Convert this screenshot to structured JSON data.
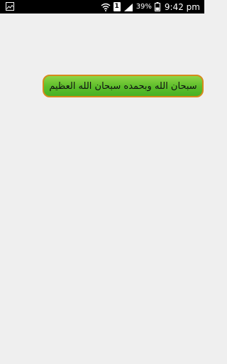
{
  "status_bar": {
    "left_icon": "gallery-image-icon",
    "icons": [
      "wifi-icon",
      "sim-1-icon",
      "signal-icon",
      "battery-icon"
    ],
    "sim_slot": "1",
    "battery_percent": "39%",
    "time": "9:42 pm"
  },
  "main": {
    "zikr_button_label": "سبحان الله وبحمده سبحان الله العظيم"
  },
  "colors": {
    "status_bar_bg": "#000000",
    "background": "#efefef",
    "button_green": "#5fbf2c",
    "button_border": "#d58a1c"
  }
}
